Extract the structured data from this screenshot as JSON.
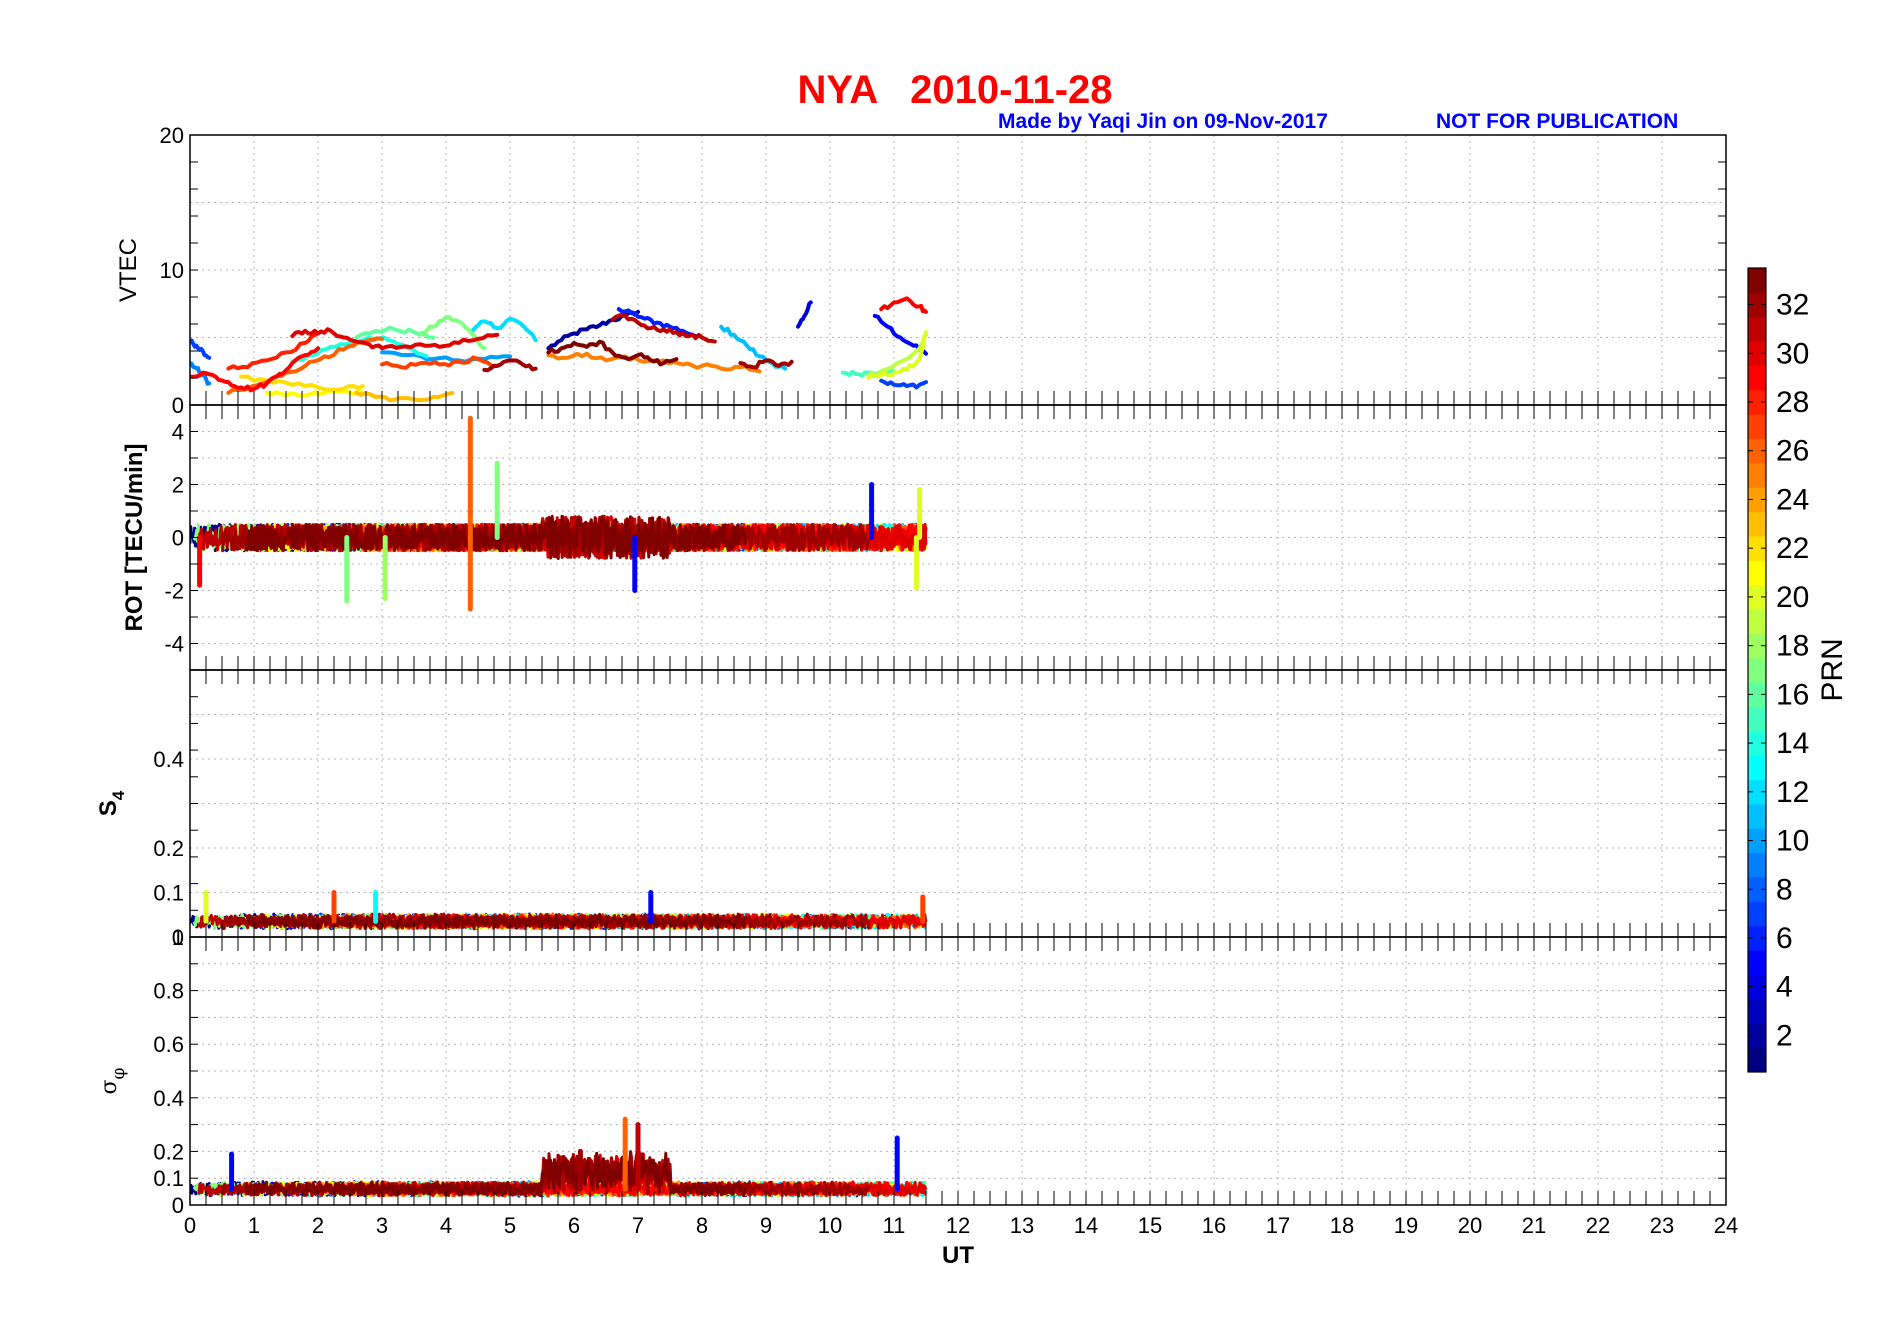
{
  "figure": {
    "title": "NYA   2010-11-28",
    "credit": "Made by Yaqi Jin on 09-Nov-2017",
    "notice": "NOT FOR PUBLICATION",
    "title_color": "#ff0000",
    "credit_color": "#0000ff"
  },
  "colorbar": {
    "label": "PRN",
    "min": 1,
    "max": 33,
    "ticks": [
      "2",
      "4",
      "6",
      "8",
      "10",
      "12",
      "14",
      "16",
      "18",
      "20",
      "22",
      "24",
      "26",
      "28",
      "30",
      "32"
    ],
    "colormap": "jet"
  },
  "chart_data": [
    {
      "type": "line",
      "panel": "vtec",
      "ylabel": "VTEC",
      "ylim": [
        0,
        20
      ],
      "yticks": [
        "0",
        "10",
        "20"
      ],
      "xlim": [
        0,
        24
      ],
      "grid": true,
      "data_extent_ut": [
        0,
        11.5
      ],
      "series": [
        {
          "prn": 2,
          "x": [
            5.6,
            5.8,
            6.0,
            6.2,
            6.4,
            6.6,
            6.8,
            7.0
          ],
          "y": [
            4.2,
            4.8,
            5.3,
            5.6,
            5.9,
            6.3,
            6.6,
            6.9
          ]
        },
        {
          "prn": 4,
          "x": [
            9.5,
            9.6,
            9.7
          ],
          "y": [
            5.8,
            6.6,
            7.6
          ]
        },
        {
          "prn": 5,
          "x": [
            10.7,
            10.9,
            11.1,
            11.3,
            11.5
          ],
          "y": [
            6.6,
            5.8,
            5.0,
            4.4,
            3.8
          ]
        },
        {
          "prn": 6,
          "x": [
            6.7,
            6.9,
            7.1,
            7.3,
            7.5,
            7.7,
            7.9
          ],
          "y": [
            7.1,
            6.8,
            6.4,
            6.1,
            5.8,
            5.5,
            5.1
          ]
        },
        {
          "prn": 7,
          "x": [
            0.0,
            0.1,
            0.2,
            0.3
          ],
          "y": [
            4.7,
            4.4,
            4.0,
            3.5
          ]
        },
        {
          "prn": 7,
          "x": [
            10.8,
            11.0,
            11.2,
            11.4,
            11.5
          ],
          "y": [
            1.8,
            1.5,
            1.4,
            1.5,
            1.7
          ]
        },
        {
          "prn": 9,
          "x": [
            0.0,
            0.1,
            0.2,
            0.3
          ],
          "y": [
            3.1,
            2.7,
            2.2,
            1.6
          ]
        },
        {
          "prn": 10,
          "x": [
            3.0,
            3.4,
            3.8,
            4.2,
            4.6,
            5.0
          ],
          "y": [
            3.9,
            3.7,
            3.4,
            3.3,
            3.4,
            3.6
          ]
        },
        {
          "prn": 11,
          "x": [
            8.3,
            8.5,
            8.7,
            8.9,
            9.1,
            9.3
          ],
          "y": [
            5.8,
            5.2,
            4.4,
            3.6,
            3.1,
            2.7
          ]
        },
        {
          "prn": 12,
          "x": [
            4.4,
            4.6,
            4.8,
            5.0,
            5.2,
            5.4
          ],
          "y": [
            5.4,
            6.2,
            5.7,
            6.4,
            5.9,
            4.8
          ]
        },
        {
          "prn": 14,
          "x": [
            1.6,
            1.9,
            2.2,
            2.5,
            2.8,
            3.1,
            3.4,
            3.7
          ],
          "y": [
            3.2,
            3.7,
            4.3,
            4.6,
            5.0,
            4.8,
            4.2,
            3.6
          ]
        },
        {
          "prn": 15,
          "x": [
            10.2,
            10.4,
            10.6,
            10.8,
            11.0
          ],
          "y": [
            2.4,
            2.3,
            2.4,
            2.5,
            2.5
          ]
        },
        {
          "prn": 16,
          "x": [
            2.6,
            2.9,
            3.2,
            3.5,
            3.8
          ],
          "y": [
            5.0,
            5.5,
            5.6,
            5.4,
            5.0
          ]
        },
        {
          "prn": 17,
          "x": [
            3.6,
            3.8,
            4.0,
            4.2,
            4.4,
            4.6
          ],
          "y": [
            5.2,
            5.8,
            6.5,
            6.2,
            5.3,
            4.2
          ]
        },
        {
          "prn": 19,
          "x": [
            10.6,
            10.8,
            11.0,
            11.2,
            11.4,
            11.5
          ],
          "y": [
            2.2,
            2.5,
            2.9,
            3.4,
            4.2,
            5.2
          ]
        },
        {
          "prn": 20,
          "x": [
            10.6,
            10.8,
            11.0,
            11.2,
            11.4,
            11.5
          ],
          "y": [
            2.0,
            2.2,
            2.4,
            2.6,
            3.4,
            5.4
          ]
        },
        {
          "prn": 21,
          "x": [
            1.2,
            1.5,
            1.8,
            2.1,
            2.4,
            2.7
          ],
          "y": [
            0.9,
            0.7,
            0.7,
            0.9,
            1.0,
            0.9
          ]
        },
        {
          "prn": 22,
          "x": [
            0.8,
            1.2,
            1.6,
            2.0,
            2.4,
            2.7
          ],
          "y": [
            2.1,
            1.8,
            1.5,
            1.3,
            1.2,
            1.4
          ]
        },
        {
          "prn": 23,
          "x": [
            2.6,
            2.9,
            3.2,
            3.5,
            3.8,
            4.1
          ],
          "y": [
            0.9,
            0.6,
            0.4,
            0.4,
            0.6,
            0.9
          ]
        },
        {
          "prn": 25,
          "x": [
            5.6,
            5.9,
            6.2,
            6.5,
            6.8,
            7.1,
            7.4,
            7.7,
            8.0,
            8.3,
            8.6,
            8.9
          ],
          "y": [
            3.7,
            3.5,
            3.8,
            3.3,
            3.6,
            3.2,
            3.3,
            3.0,
            2.9,
            2.7,
            2.8,
            2.5
          ]
        },
        {
          "prn": 26,
          "x": [
            0.6,
            0.9,
            1.2,
            1.5,
            1.8,
            2.1,
            2.4,
            2.7,
            3.0
          ],
          "y": [
            0.9,
            1.2,
            1.7,
            2.4,
            2.9,
            3.6,
            4.1,
            4.6,
            4.9
          ]
        },
        {
          "prn": 27,
          "x": [
            3.0,
            3.3,
            3.6,
            3.9,
            4.2,
            4.5,
            4.8
          ],
          "y": [
            3.0,
            2.8,
            3.1,
            3.0,
            3.2,
            3.4,
            2.9
          ]
        },
        {
          "prn": 28,
          "x": [
            0.6,
            0.9,
            1.2,
            1.5,
            1.8,
            2.0
          ],
          "y": [
            2.7,
            2.8,
            3.3,
            3.9,
            4.6,
            5.3
          ]
        },
        {
          "prn": 29,
          "x": [
            0.0,
            0.2,
            0.4,
            0.6,
            0.8,
            1.0,
            1.2,
            1.4,
            1.6,
            1.8,
            2.0
          ],
          "y": [
            2.1,
            2.4,
            2.1,
            1.7,
            1.3,
            1.2,
            1.6,
            2.3,
            3.1,
            3.7,
            4.2
          ]
        },
        {
          "prn": 29,
          "x": [
            10.8,
            11.0,
            11.2,
            11.4,
            11.5
          ],
          "y": [
            7.1,
            7.6,
            7.9,
            7.3,
            6.9
          ]
        },
        {
          "prn": 30,
          "x": [
            1.6,
            1.8,
            2.0,
            2.2,
            2.4,
            2.6,
            2.8,
            3.0,
            3.3,
            3.6,
            3.9,
            4.2,
            4.5,
            4.8
          ],
          "y": [
            5.1,
            5.5,
            5.3,
            5.5,
            5.0,
            4.7,
            4.5,
            4.2,
            4.3,
            4.5,
            4.3,
            4.6,
            4.9,
            5.2
          ]
        },
        {
          "prn": 31,
          "x": [
            6.6,
            6.8,
            7.0,
            7.2,
            7.4,
            7.6,
            7.8,
            8.0,
            8.2
          ],
          "y": [
            6.3,
            6.6,
            6.1,
            5.7,
            5.6,
            5.4,
            5.1,
            5.0,
            4.7
          ]
        },
        {
          "prn": 32,
          "x": [
            4.6,
            4.8,
            5.0,
            5.2,
            5.4
          ],
          "y": [
            2.6,
            2.9,
            3.3,
            3.0,
            2.7
          ]
        },
        {
          "prn": 32,
          "x": [
            8.6,
            8.8,
            9.0,
            9.2,
            9.4
          ],
          "y": [
            3.1,
            2.8,
            3.3,
            2.9,
            3.2
          ]
        },
        {
          "prn": 33,
          "x": [
            5.6,
            5.8,
            6.0,
            6.2,
            6.4,
            6.6,
            6.8,
            7.0,
            7.2,
            7.4,
            7.6
          ],
          "y": [
            3.9,
            4.2,
            4.6,
            4.3,
            4.7,
            3.9,
            3.5,
            3.7,
            3.3,
            3.1,
            3.4
          ]
        }
      ]
    },
    {
      "type": "line",
      "panel": "rot",
      "ylabel": "ROT [TECU/min]",
      "ylim": [
        -5,
        5
      ],
      "yticks": [
        "-4",
        "-2",
        "0",
        "2",
        "4"
      ],
      "xlim": [
        0,
        24
      ],
      "grid": true,
      "data_extent_ut": [
        0,
        11.5
      ],
      "description_of_values": "fluctuations mostly within ±1.5 TECU/min",
      "spikes": [
        {
          "x": 4.38,
          "y": 4.5,
          "prn": 26
        },
        {
          "x": 4.38,
          "y": -2.7,
          "prn": 26
        },
        {
          "x": 4.8,
          "y": 2.8,
          "prn": 17
        },
        {
          "x": 2.45,
          "y": -2.4,
          "prn": 17
        },
        {
          "x": 3.05,
          "y": -2.3,
          "prn": 18
        },
        {
          "x": 6.95,
          "y": -2.0,
          "prn": 5
        },
        {
          "x": 10.65,
          "y": 2.0,
          "prn": 5
        },
        {
          "x": 11.4,
          "y": 1.8,
          "prn": 20
        },
        {
          "x": 11.35,
          "y": -1.9,
          "prn": 20
        },
        {
          "x": 0.15,
          "y": -1.8,
          "prn": 29
        }
      ]
    },
    {
      "type": "line",
      "panel": "s4",
      "ylabel": "S4",
      "ylim": [
        0,
        0.6
      ],
      "yticks": [
        "0",
        "0.1",
        "0.2",
        "0.4"
      ],
      "xlim": [
        0,
        24
      ],
      "grid": true,
      "data_extent_ut": [
        0,
        11.5
      ],
      "description_of_values": "mostly 0.02-0.06 with peaks near 0.1",
      "peaks": [
        {
          "x": 0.25,
          "y": 0.1,
          "prn": 20
        },
        {
          "x": 2.25,
          "y": 0.1,
          "prn": 27
        },
        {
          "x": 2.9,
          "y": 0.1,
          "prn": 13
        },
        {
          "x": 7.2,
          "y": 0.1,
          "prn": 5
        },
        {
          "x": 11.45,
          "y": 0.09,
          "prn": 27
        }
      ]
    },
    {
      "type": "line",
      "panel": "sigma_phi",
      "ylabel": "σφ",
      "ylim": [
        0,
        1
      ],
      "yticks": [
        "0",
        "0.1",
        "0.2",
        "0.4",
        "0.6",
        "0.8",
        "1"
      ],
      "xlim": [
        0,
        24
      ],
      "xlabel": "UT",
      "xticks": [
        "0",
        "1",
        "2",
        "3",
        "4",
        "5",
        "6",
        "7",
        "8",
        "9",
        "10",
        "11",
        "12",
        "13",
        "14",
        "15",
        "16",
        "17",
        "18",
        "19",
        "20",
        "21",
        "22",
        "23",
        "24"
      ],
      "grid": true,
      "data_extent_ut": [
        0,
        11.5
      ],
      "description_of_values": "mostly 0.03-0.1, enhanced 0.1-0.3 between 5.5 and 7.5 UT",
      "peaks": [
        {
          "x": 6.8,
          "y": 0.32,
          "prn": 26
        },
        {
          "x": 7.0,
          "y": 0.3,
          "prn": 31
        },
        {
          "x": 6.1,
          "y": 0.2,
          "prn": 32
        },
        {
          "x": 11.05,
          "y": 0.25,
          "prn": 5
        },
        {
          "x": 0.65,
          "y": 0.19,
          "prn": 5
        }
      ]
    }
  ]
}
